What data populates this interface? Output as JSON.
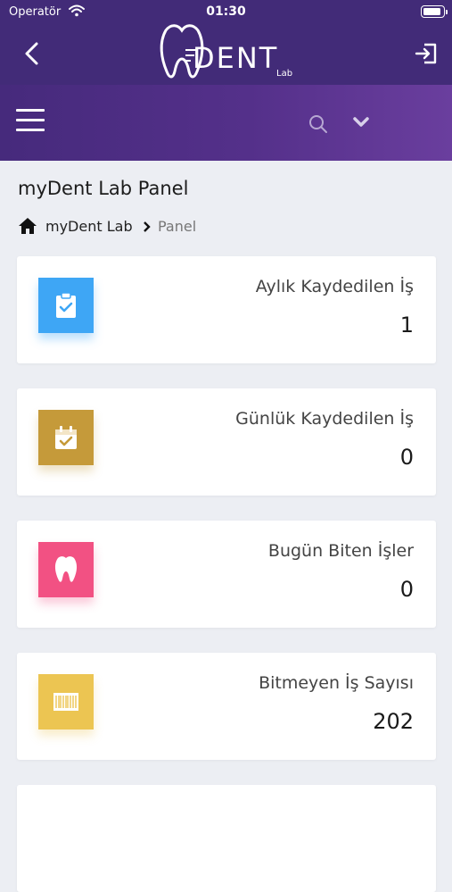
{
  "status_bar": {
    "carrier": "Operatör",
    "time": "01:30"
  },
  "app_bar": {
    "logo_text": "DENT",
    "logo_sub": "Lab"
  },
  "page": {
    "title": "myDent Lab Panel"
  },
  "breadcrumb": {
    "home": "myDent Lab",
    "current": "Panel"
  },
  "cards": [
    {
      "label": "Aylık Kaydedilen İş",
      "value": "1",
      "icon": "clipboard-check-icon",
      "color": "#3ea6f5"
    },
    {
      "label": "Günlük Kaydedilen İş",
      "value": "0",
      "icon": "calendar-check-icon",
      "color": "#c59a3a"
    },
    {
      "label": "Bugün Biten İşler",
      "value": "0",
      "icon": "tooth-icon",
      "color": "#f25183"
    },
    {
      "label": "Bitmeyen İş Sayısı",
      "value": "202",
      "icon": "barcode-icon",
      "color": "#ecc552"
    }
  ]
}
